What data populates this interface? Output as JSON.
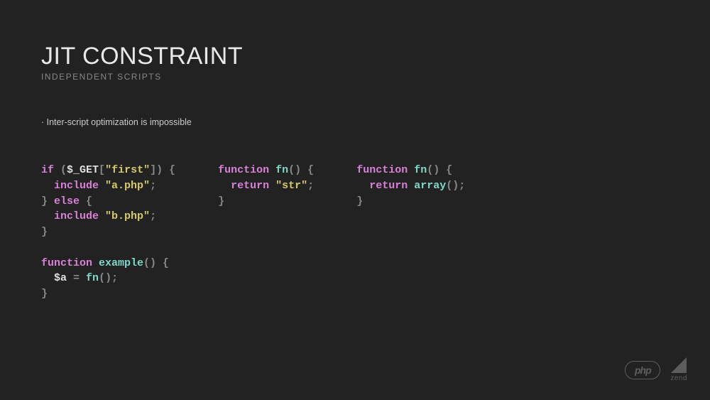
{
  "title": "JIT CONSTRAINT",
  "subtitle": "INDEPENDENT SCRIPTS",
  "bullet": "· Inter-script optimization is impossible",
  "code": {
    "col1": {
      "tokens": [
        {
          "t": "if",
          "c": "kw"
        },
        {
          "t": " (",
          "c": "paren"
        },
        {
          "t": "$_GET",
          "c": "var"
        },
        {
          "t": "[",
          "c": "paren"
        },
        {
          "t": "\"first\"",
          "c": "str"
        },
        {
          "t": "]",
          "c": "paren"
        },
        {
          "t": ") {",
          "c": "brace"
        },
        {
          "t": "\n  ",
          "c": "var"
        },
        {
          "t": "include",
          "c": "kw"
        },
        {
          "t": " ",
          "c": "var"
        },
        {
          "t": "\"a.php\"",
          "c": "str"
        },
        {
          "t": ";",
          "c": "punct"
        },
        {
          "t": "\n} ",
          "c": "brace"
        },
        {
          "t": "else",
          "c": "kw"
        },
        {
          "t": " {",
          "c": "brace"
        },
        {
          "t": "\n  ",
          "c": "var"
        },
        {
          "t": "include",
          "c": "kw"
        },
        {
          "t": " ",
          "c": "var"
        },
        {
          "t": "\"b.php\"",
          "c": "str"
        },
        {
          "t": ";",
          "c": "punct"
        },
        {
          "t": "\n}",
          "c": "brace"
        },
        {
          "t": "\n\n",
          "c": "var"
        },
        {
          "t": "function",
          "c": "kw"
        },
        {
          "t": " ",
          "c": "var"
        },
        {
          "t": "example",
          "c": "fn"
        },
        {
          "t": "() {",
          "c": "brace"
        },
        {
          "t": "\n  ",
          "c": "var"
        },
        {
          "t": "$a",
          "c": "var"
        },
        {
          "t": " = ",
          "c": "eq"
        },
        {
          "t": "fn",
          "c": "fn"
        },
        {
          "t": "();",
          "c": "punct"
        },
        {
          "t": "\n}",
          "c": "brace"
        }
      ]
    },
    "col2": {
      "tokens": [
        {
          "t": "function",
          "c": "kw"
        },
        {
          "t": " ",
          "c": "var"
        },
        {
          "t": "fn",
          "c": "fn"
        },
        {
          "t": "() {",
          "c": "brace"
        },
        {
          "t": "\n  ",
          "c": "var"
        },
        {
          "t": "return",
          "c": "kw"
        },
        {
          "t": " ",
          "c": "var"
        },
        {
          "t": "\"str\"",
          "c": "str"
        },
        {
          "t": ";",
          "c": "punct"
        },
        {
          "t": "\n}",
          "c": "brace"
        }
      ]
    },
    "col3": {
      "tokens": [
        {
          "t": "function",
          "c": "kw"
        },
        {
          "t": " ",
          "c": "var"
        },
        {
          "t": "fn",
          "c": "fn"
        },
        {
          "t": "() {",
          "c": "brace"
        },
        {
          "t": "\n  ",
          "c": "var"
        },
        {
          "t": "return",
          "c": "kw"
        },
        {
          "t": " ",
          "c": "var"
        },
        {
          "t": "array",
          "c": "fn"
        },
        {
          "t": "();",
          "c": "punct"
        },
        {
          "t": "\n}",
          "c": "brace"
        }
      ]
    }
  },
  "logos": {
    "php": "php",
    "zend": "zend"
  }
}
